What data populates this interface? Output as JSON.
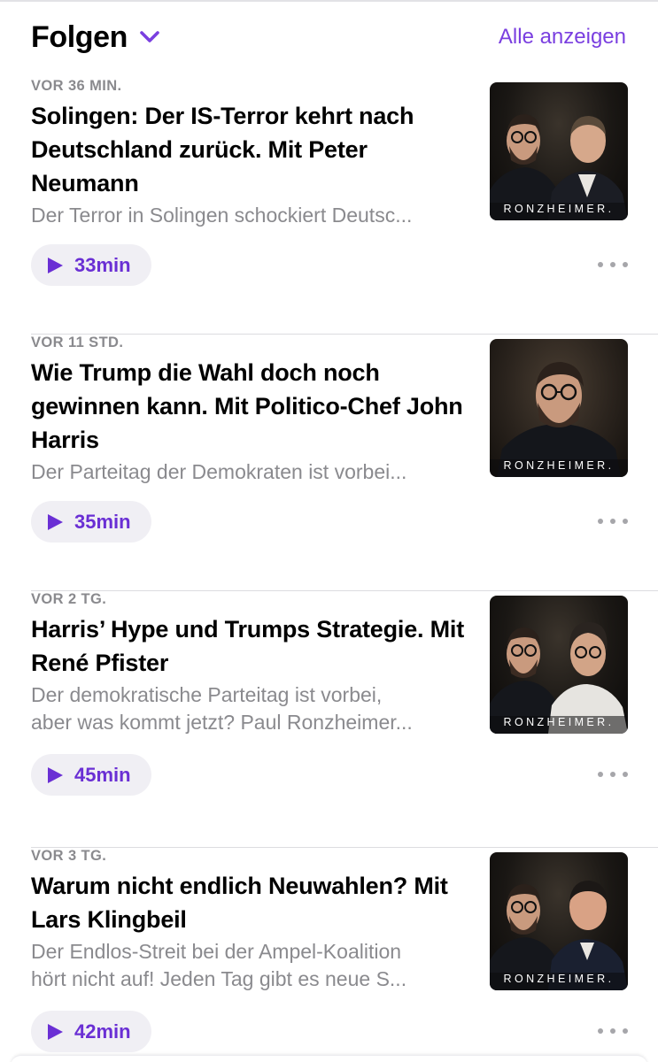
{
  "section": {
    "title": "Folgen",
    "see_all": "Alle anzeigen"
  },
  "episodes": [
    {
      "date": "VOR 36 MIN.",
      "title": "Solingen: Der IS-Terror kehrt nach Deutschland zurück. Mit Peter Neumann",
      "desc_lines": [
        "Der Terror in Solingen schockiert Deutsc..."
      ],
      "duration": "33min",
      "artwork_brand": "RONZHEIMER."
    },
    {
      "date": "VOR 11 STD.",
      "title": "Wie Trump die Wahl doch noch gewinnen kann. Mit Politico-Chef John Harris",
      "desc_lines": [
        "Der Parteitag der Demokraten ist vorbei..."
      ],
      "duration": "35min",
      "artwork_brand": "RONZHEIMER."
    },
    {
      "date": "VOR 2 TG.",
      "title": "Harris’ Hype und Trumps Strategie. Mit René Pfister",
      "desc_lines": [
        "Der demokratische Parteitag ist vorbei,",
        "aber was kommt jetzt?  Paul Ronzheimer..."
      ],
      "duration": "45min",
      "artwork_brand": "RONZHEIMER."
    },
    {
      "date": "VOR 3 TG.",
      "title": "Warum nicht endlich Neuwahlen? Mit Lars Klingbeil",
      "desc_lines": [
        "Der Endlos-Streit bei der Ampel-Koalition",
        "hört nicht auf!  Jeden Tag gibt es neue S..."
      ],
      "duration": "42min",
      "artwork_brand": "RONZHEIMER."
    }
  ],
  "colors": {
    "accent": "#7a3fe0",
    "play_text": "#6a2fd4",
    "secondary_text": "#8a8a8e",
    "pill_bg": "#f0eff4"
  },
  "icons": {
    "section_chevron": "chevron-down-icon",
    "play": "play-icon",
    "more": "ellipsis-icon"
  }
}
